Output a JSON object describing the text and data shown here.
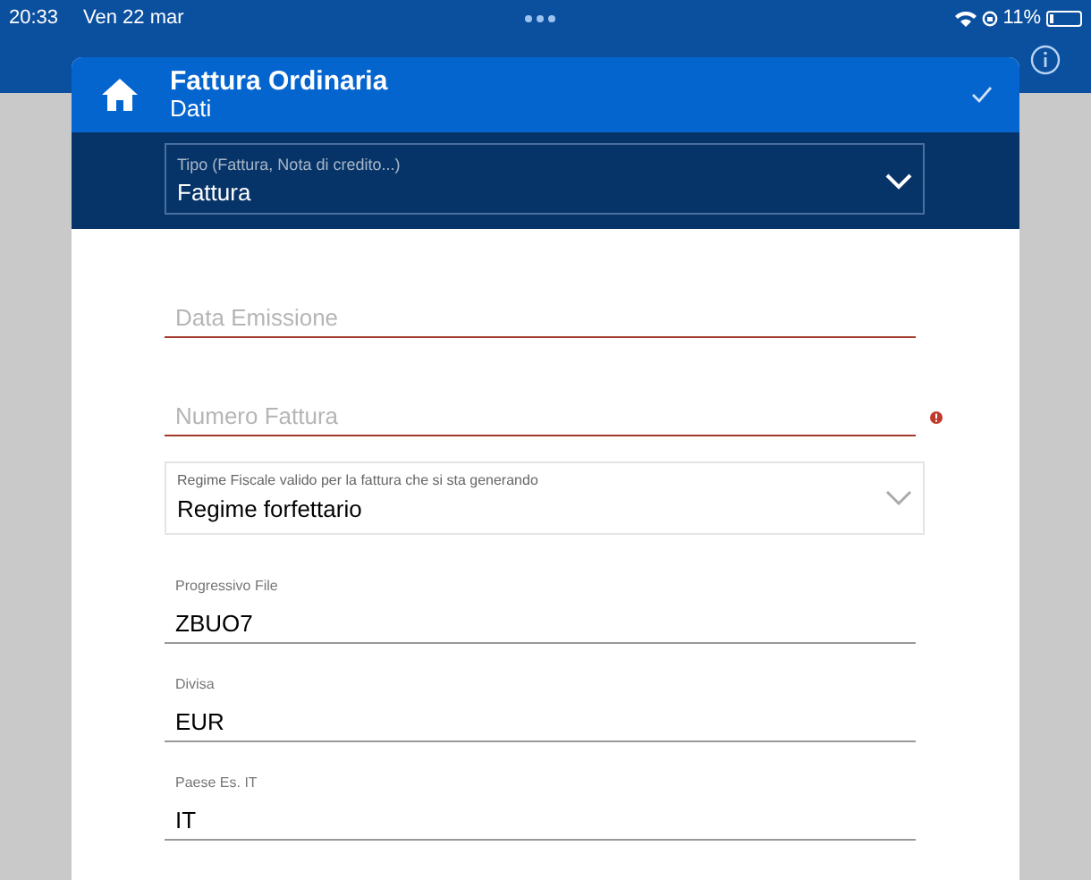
{
  "status_bar": {
    "time": "20:33",
    "date": "Ven 22 mar",
    "battery": "11%"
  },
  "modal": {
    "title": "Fattura Ordinaria",
    "subtitle": "Dati",
    "type_select": {
      "label": "Tipo (Fattura, Nota di credito...)",
      "value": "Fattura"
    },
    "fields": [
      {
        "kind": "text",
        "placeholder": "Data Emissione",
        "invalid": true,
        "alert": false
      },
      {
        "kind": "text",
        "placeholder": "Numero Fattura",
        "invalid": true,
        "alert": true
      },
      {
        "kind": "dropdown",
        "label": "Regime Fiscale valido per la fattura che si sta generando",
        "value": "Regime forfettario"
      },
      {
        "kind": "text",
        "label": "Progressivo File",
        "value": "ZBUO7",
        "invalid": false,
        "alert": false
      },
      {
        "kind": "text",
        "label": "Divisa",
        "value": "EUR",
        "invalid": false,
        "alert": false
      },
      {
        "kind": "text",
        "label": "Paese Es. IT",
        "value": "IT",
        "invalid": false,
        "alert": false
      }
    ]
  }
}
